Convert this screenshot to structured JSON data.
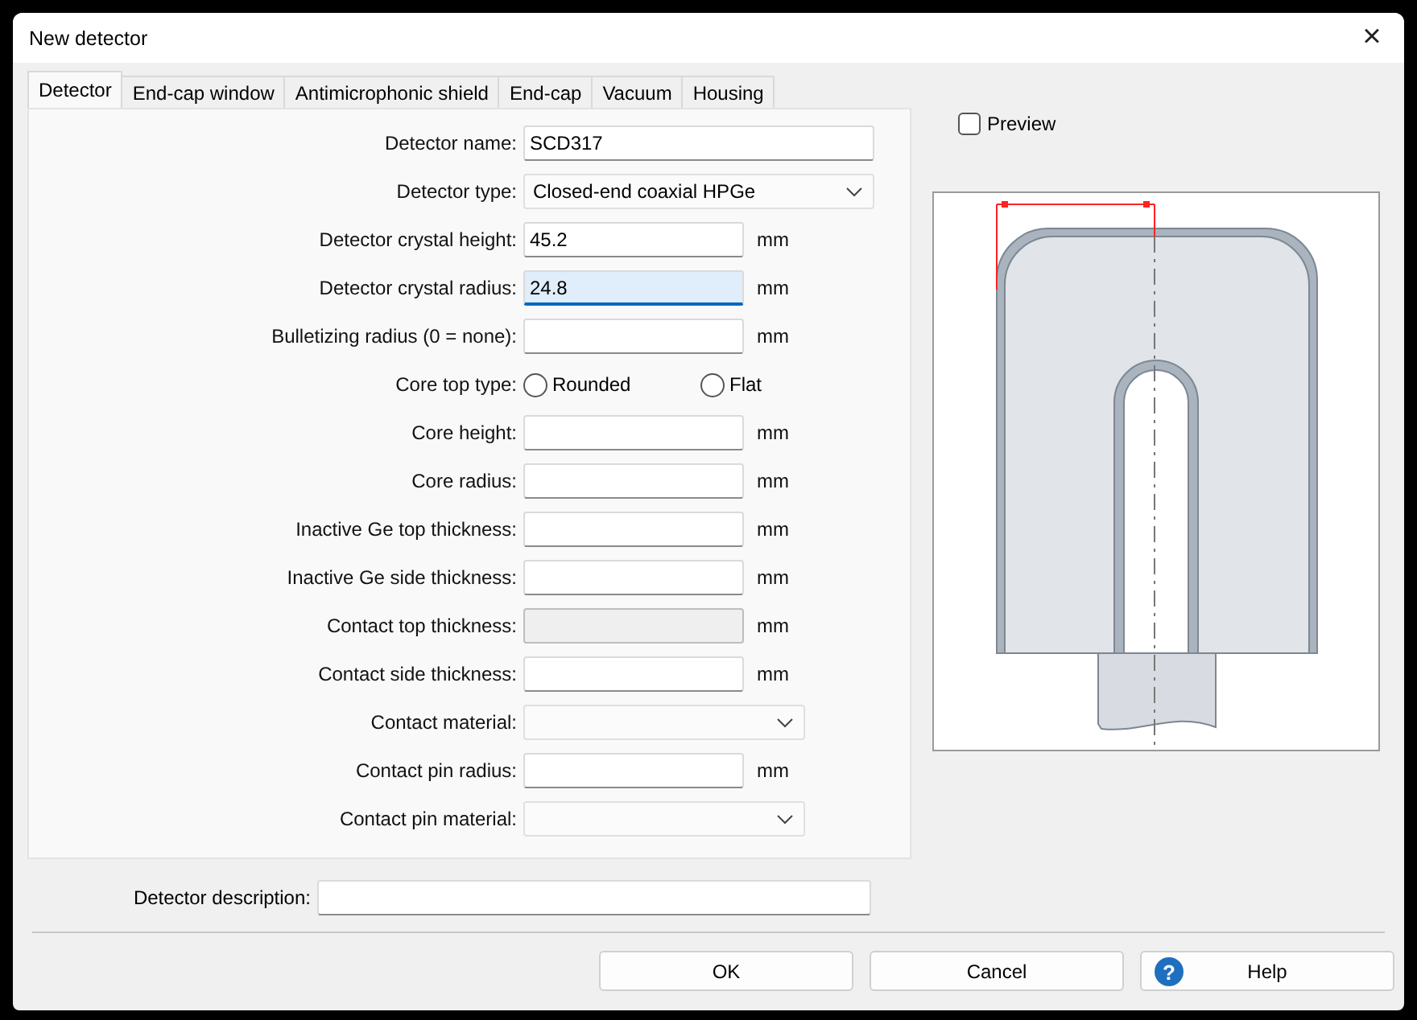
{
  "window": {
    "title": "New detector",
    "close": "×"
  },
  "tabs": [
    {
      "label": "Detector",
      "selected": true
    },
    {
      "label": "End-cap window",
      "selected": false
    },
    {
      "label": "Antimicrophonic shield",
      "selected": false
    },
    {
      "label": "End-cap",
      "selected": false
    },
    {
      "label": "Vacuum",
      "selected": false
    },
    {
      "label": "Housing",
      "selected": false
    }
  ],
  "fields": [
    {
      "kind": "text",
      "label": "Detector name:",
      "value": "SCD317",
      "wide": true
    },
    {
      "kind": "select",
      "label": "Detector type:",
      "value": "Closed-end coaxial HPGe",
      "wide": true
    },
    {
      "kind": "text",
      "label": "Detector crystal height:",
      "value": "45.2",
      "unit": "mm"
    },
    {
      "kind": "text",
      "label": "Detector crystal radius:",
      "value": "24.8",
      "unit": "mm",
      "focused": true
    },
    {
      "kind": "text",
      "label": "Bulletizing radius (0 = none):",
      "unit": "mm"
    },
    {
      "kind": "radio",
      "label": "Core top type:",
      "options": [
        {
          "label": "Rounded",
          "selected": false
        },
        {
          "label": "Flat",
          "selected": false
        }
      ]
    },
    {
      "kind": "text",
      "label": "Core height:",
      "unit": "mm"
    },
    {
      "kind": "text",
      "label": "Core radius:",
      "unit": "mm"
    },
    {
      "kind": "text",
      "label": "Inactive Ge top thickness:",
      "unit": "mm"
    },
    {
      "kind": "text",
      "label": "Inactive Ge side thickness:",
      "unit": "mm"
    },
    {
      "kind": "text",
      "label": "Contact top thickness:",
      "unit": "mm",
      "disabled": true
    },
    {
      "kind": "text",
      "label": "Contact side thickness:",
      "unit": "mm"
    },
    {
      "kind": "select",
      "label": "Contact material:"
    },
    {
      "kind": "text",
      "label": "Contact pin radius:",
      "unit": "mm"
    },
    {
      "kind": "select",
      "label": "Contact pin material:"
    }
  ],
  "preview": {
    "label": "Preview",
    "checked": false
  },
  "description": {
    "label": "Detector description:"
  },
  "buttons": [
    {
      "label": "OK",
      "kind": "plain"
    },
    {
      "label": "Cancel",
      "kind": "plain"
    },
    {
      "label": "Help",
      "kind": "help",
      "icon": "?"
    }
  ]
}
